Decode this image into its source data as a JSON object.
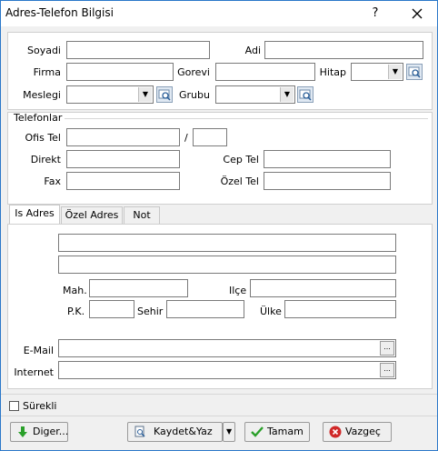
{
  "window": {
    "title": "Adres-Telefon Bilgisi",
    "help_glyph": "?",
    "close_glyph": "X"
  },
  "person": {
    "soyadi_label": "Soyadi",
    "adi_label": "Adi",
    "firma_label": "Firma",
    "gorevi_label": "Gorevi",
    "hitap_label": "Hitap",
    "meslegi_label": "Meslegi",
    "grubu_label": "Grubu"
  },
  "telefonlar": {
    "title": "Telefonlar",
    "ofis_label": "Ofis Tel",
    "slash": "/",
    "direkt_label": "Direkt",
    "fax_label": "Fax",
    "cep_label": "Cep Tel",
    "ozel_label": "Özel Tel"
  },
  "tabs": [
    {
      "label": "Is Adres",
      "active": true
    },
    {
      "label": "Özel Adres",
      "active": false
    },
    {
      "label": "Not",
      "active": false
    }
  ],
  "address": {
    "mah_label": "Mah.",
    "ilce_label": "Ilçe",
    "pk_label": "P.K.",
    "sehir_label": "Sehir",
    "ulke_label": "Ülke",
    "email_label": "E-Mail",
    "internet_label": "Internet",
    "ellipsis": "..."
  },
  "footer": {
    "surekli_label": "Sürekli",
    "diger_label": "Diger...",
    "kaydet_label": "Kaydet&Yaz",
    "tamam_label": "Tamam",
    "vazgec_label": "Vazgeç"
  },
  "colors": {
    "accent": "#2b78c9",
    "ok_green": "#2aa02a",
    "cancel_red": "#d02828"
  }
}
